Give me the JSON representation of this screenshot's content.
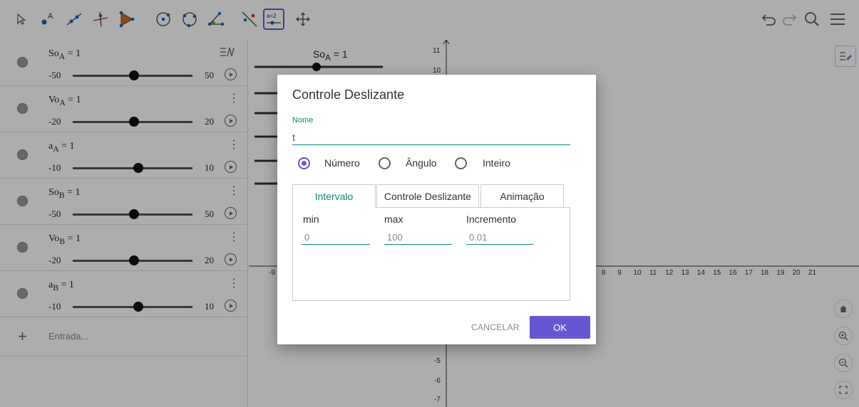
{
  "toolbar": {
    "tools": [
      {
        "name": "move-tool-icon"
      },
      {
        "name": "point-tool-icon",
        "glyph": "A"
      },
      {
        "name": "line-tool-icon"
      },
      {
        "name": "perpendicular-tool-icon"
      },
      {
        "name": "polygon-tool-icon"
      },
      {
        "name": "circle-tool-icon"
      },
      {
        "name": "circle-three-points-tool-icon"
      },
      {
        "name": "angle-tool-icon"
      },
      {
        "name": "reflect-tool-icon"
      },
      {
        "name": "slider-tool-icon",
        "glyph": "a=2"
      },
      {
        "name": "move-graphics-tool-icon"
      }
    ]
  },
  "algebra": {
    "rows": [
      {
        "var": "So",
        "sub": "A",
        "value": "1",
        "min": "-50",
        "max": "50",
        "knob": 0.5
      },
      {
        "var": "Vo",
        "sub": "A",
        "value": "1",
        "min": "-20",
        "max": "20",
        "knob": 0.5
      },
      {
        "var": "a",
        "sub": "A",
        "value": "1",
        "min": "-10",
        "max": "10",
        "knob": 0.55
      },
      {
        "var": "So",
        "sub": "B",
        "value": "1",
        "min": "-50",
        "max": "50",
        "knob": 0.5
      },
      {
        "var": "Vo",
        "sub": "B",
        "value": "1",
        "min": "-20",
        "max": "20",
        "knob": 0.5
      },
      {
        "var": "a",
        "sub": "B",
        "value": "1",
        "min": "-10",
        "max": "10",
        "knob": 0.55
      }
    ],
    "input_placeholder": "Entrada..."
  },
  "graphics": {
    "slider_label_var": "So",
    "slider_label_sub": "A",
    "slider_label_value": "= 1",
    "y_ticks_top": [
      "11",
      "10"
    ],
    "y_ticks_bottom": [
      "-5",
      "-6",
      "-7"
    ],
    "x_ticks": [
      "8",
      "9",
      "10",
      "11",
      "12",
      "13",
      "14",
      "15",
      "16",
      "17",
      "18",
      "19",
      "20",
      "21"
    ],
    "x_tick_left": "-9"
  },
  "dialog": {
    "title": "Controle Deslizante",
    "name_label": "Nome",
    "name_value": "t",
    "radios": [
      {
        "label": "Número",
        "checked": true
      },
      {
        "label": "Ângulo",
        "checked": false
      },
      {
        "label": "Inteiro",
        "checked": false
      }
    ],
    "tabs": [
      "Intervalo",
      "Controle Deslizante",
      "Animação"
    ],
    "fields": {
      "min_label": "min",
      "min_value": "0",
      "max_label": "max",
      "max_value": "100",
      "inc_label": "Incremento",
      "inc_value": "0.01"
    },
    "cancel_label": "CANCELAR",
    "ok_label": "OK"
  },
  "colors": {
    "accent": "#6557d2",
    "teal": "#0a8a78"
  }
}
